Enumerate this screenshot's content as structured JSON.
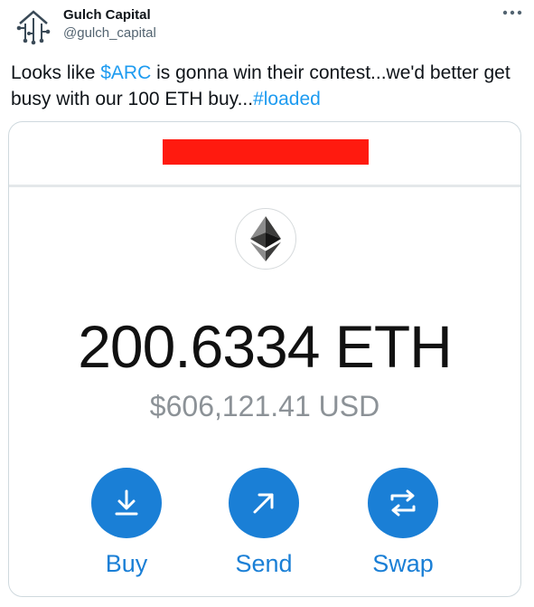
{
  "tweet": {
    "author": {
      "display_name": "Gulch Capital",
      "handle": "@gulch_capital"
    },
    "text": {
      "part1": "Looks like ",
      "cashtag": "$ARC",
      "part2": " is gonna win their contest...we'd better get busy with our 100 ETH buy...",
      "hashtag": "#loaded"
    },
    "more_icon": "more-horizontal-icon"
  },
  "wallet": {
    "token_icon": "ethereum-icon",
    "balance": "200.6334 ETH",
    "usd_value": "$606,121.41 USD",
    "actions": [
      {
        "label": "Buy",
        "icon": "download-icon"
      },
      {
        "label": "Send",
        "icon": "arrow-up-right-icon"
      },
      {
        "label": "Swap",
        "icon": "swap-arrows-icon"
      }
    ]
  },
  "colors": {
    "link": "#1d9bf0",
    "wallet_accent": "#1a7fd6",
    "redaction": "#ff1a0f",
    "secondary_text": "#536471"
  }
}
